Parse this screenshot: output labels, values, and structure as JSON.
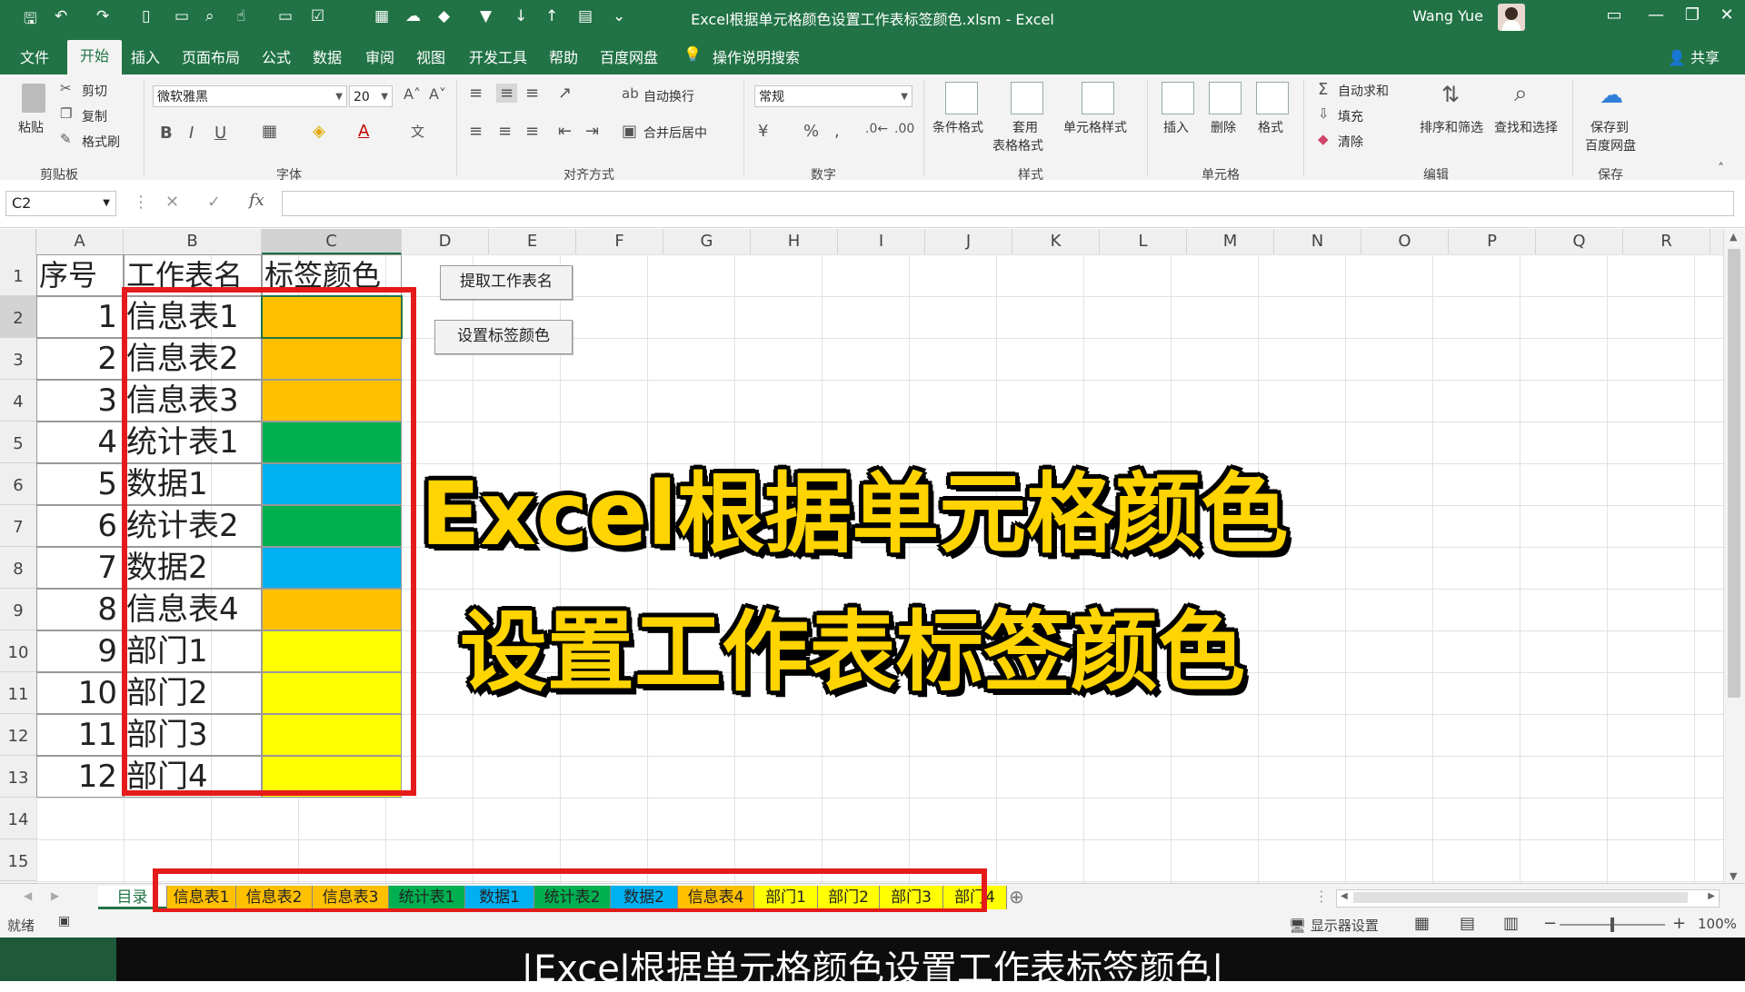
{
  "window": {
    "title": "Excel根据单元格颜色设置工作表标签颜色.xlsm  -  Excel",
    "user": "Wang Yue"
  },
  "menu": [
    "文件",
    "开始",
    "插入",
    "页面布局",
    "公式",
    "数据",
    "审阅",
    "视图",
    "开发工具",
    "帮助",
    "百度网盘"
  ],
  "menu_search": "操作说明搜索",
  "share": "共享",
  "ribbon": {
    "clipboard": {
      "paste": "粘贴",
      "cut": "剪切",
      "copy": "复制",
      "painter": "格式刷",
      "group": "剪贴板"
    },
    "font": {
      "name": "微软雅黑",
      "size": "20",
      "group": "字体"
    },
    "align": {
      "wrap": "自动换行",
      "merge": "合并后居中",
      "group": "对齐方式"
    },
    "number": {
      "format": "常规",
      "group": "数字"
    },
    "styles": {
      "cond": "条件格式",
      "table_l1": "套用",
      "table_l2": "表格格式",
      "cell": "单元格样式",
      "group": "样式"
    },
    "cells": {
      "insert": "插入",
      "delete": "删除",
      "format": "格式",
      "group": "单元格"
    },
    "edit": {
      "autosum": "自动求和",
      "fill": "填充",
      "clear": "清除",
      "sort": "排序和筛选",
      "find": "查找和选择",
      "group": "编辑"
    },
    "save": {
      "l1": "保存到",
      "l2": "百度网盘",
      "group": "保存"
    }
  },
  "formula": {
    "namebox": "C2"
  },
  "columns": [
    "A",
    "B",
    "C",
    "D",
    "E",
    "F",
    "G",
    "H",
    "I",
    "J",
    "K",
    "L",
    "M",
    "N",
    "O",
    "P",
    "Q",
    "R"
  ],
  "rows": [
    "1",
    "2",
    "3",
    "4",
    "5",
    "6",
    "7",
    "8",
    "9",
    "10",
    "11",
    "12",
    "13",
    "14",
    "15"
  ],
  "headers": {
    "a": "序号",
    "b": "工作表名",
    "c": "标签颜色"
  },
  "table": [
    {
      "n": "1",
      "name": "信息表1",
      "color": "#ffc000"
    },
    {
      "n": "2",
      "name": "信息表2",
      "color": "#ffc000"
    },
    {
      "n": "3",
      "name": "信息表3",
      "color": "#ffc000"
    },
    {
      "n": "4",
      "name": "统计表1",
      "color": "#00b050"
    },
    {
      "n": "5",
      "name": "数据1",
      "color": "#00b0f0"
    },
    {
      "n": "6",
      "name": "统计表2",
      "color": "#00b050"
    },
    {
      "n": "7",
      "name": "数据2",
      "color": "#00b0f0"
    },
    {
      "n": "8",
      "name": "信息表4",
      "color": "#ffc000"
    },
    {
      "n": "9",
      "name": "部门1",
      "color": "#ffff00"
    },
    {
      "n": "10",
      "name": "部门2",
      "color": "#ffff00"
    },
    {
      "n": "11",
      "name": "部门3",
      "color": "#ffff00"
    },
    {
      "n": "12",
      "name": "部门4",
      "color": "#ffff00"
    }
  ],
  "buttons": {
    "extract": "提取工作表名",
    "set_color": "设置标签颜色"
  },
  "overlay": {
    "line1": "Excel根据单元格颜色",
    "line2": "设置工作表标签颜色"
  },
  "sheet_tabs": [
    {
      "name": "目录",
      "color": "#ffffff"
    },
    {
      "name": "信息表1",
      "color": "#ffc000"
    },
    {
      "name": "信息表2",
      "color": "#ffc000"
    },
    {
      "name": "信息表3",
      "color": "#ffc000"
    },
    {
      "name": "统计表1",
      "color": "#00b050"
    },
    {
      "name": "数据1",
      "color": "#00b0f0"
    },
    {
      "name": "统计表2",
      "color": "#00b050"
    },
    {
      "name": "数据2",
      "color": "#00b0f0"
    },
    {
      "name": "信息表4",
      "color": "#ffc000"
    },
    {
      "name": "部门1",
      "color": "#ffff00"
    },
    {
      "name": "部门2",
      "color": "#ffff00"
    },
    {
      "name": "部门3",
      "color": "#ffff00"
    },
    {
      "name": "部门4",
      "color": "#ffff00"
    }
  ],
  "status": {
    "ready": "就绪",
    "display": "显示器设置",
    "zoom": "100%"
  },
  "subtitle": "|Excel根据单元格颜色设置工作表标签颜色|",
  "colors": {
    "excel_green": "#217346",
    "highlight_red": "#e51a1a",
    "overlay_yellow": "#ffd400"
  }
}
